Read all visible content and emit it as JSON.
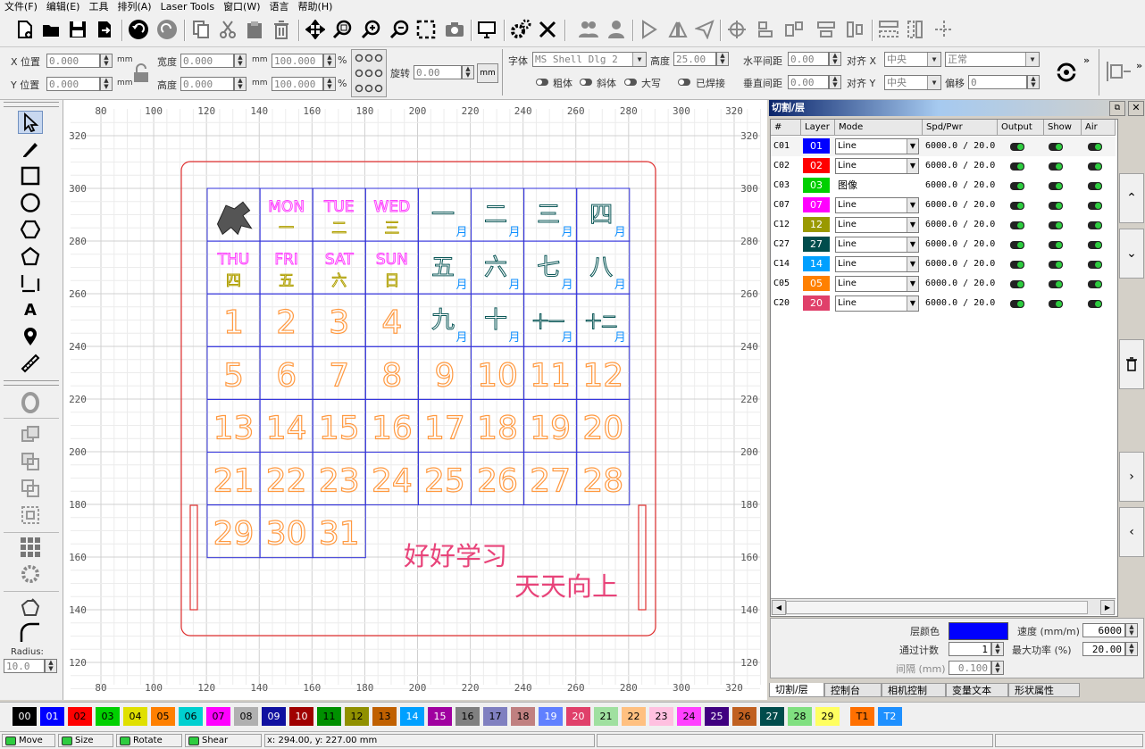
{
  "menubar": {
    "items": [
      "文件(F)",
      "编辑(E)",
      "工具",
      "排列(A)",
      "Laser Tools",
      "窗口(W)",
      "语言",
      "帮助(H)"
    ]
  },
  "properties_bar": {
    "x_pos_label": "X 位置",
    "x_pos_value": "0.000",
    "y_pos_label": "Y 位置",
    "y_pos_value": "0.000",
    "unit_mm": "mm",
    "width_label": "宽度",
    "width_value": "0.000",
    "height_label": "高度",
    "height_value": "0.000",
    "scale_x": "100.000",
    "scale_y": "100.000",
    "percent": "%",
    "rotate_label": "旋转",
    "rotate_value": "0.00",
    "rotate_unit": "mm",
    "font_label": "字体",
    "font_value": "MS Shell Dlg 2",
    "font_height_label": "高度",
    "font_height_value": "25.00",
    "hspacing_label": "水平间距",
    "hspacing_value": "0.00",
    "vspacing_label": "垂直间距",
    "vspacing_value": "0.00",
    "align_x_label": "对齐 X",
    "align_x_value": "中央",
    "align_y_label": "对齐 Y",
    "align_y_value": "中央",
    "style_value": "正常",
    "offset_label": "偏移",
    "offset_value": "0",
    "bold_label": "粗体",
    "italic_label": "斜体",
    "upper_label": "大写",
    "welded_label": "已焊接"
  },
  "toolbox": {
    "radius_label": "Radius:",
    "radius_value": "10.0"
  },
  "rulers": {
    "x_ticks": [
      "80",
      "100",
      "120",
      "140",
      "160",
      "180",
      "200",
      "220",
      "240",
      "260",
      "280",
      "300",
      "320"
    ],
    "y_ticks": [
      "320",
      "300",
      "280",
      "260",
      "240",
      "220",
      "200",
      "180",
      "160",
      "140",
      "120"
    ]
  },
  "calendar": {
    "weekday_en": [
      "MON",
      "TUE",
      "WED",
      "THU",
      "FRI",
      "SAT",
      "SUN"
    ],
    "weekday_cn": [
      "一",
      "二",
      "三",
      "四",
      "五",
      "六",
      "日"
    ],
    "months": [
      "一",
      "二",
      "三",
      "四",
      "五",
      "六",
      "七",
      "八",
      "九",
      "十",
      "十一",
      "十二"
    ],
    "month_suffix": "月",
    "days": [
      "1",
      "2",
      "3",
      "4",
      "5",
      "6",
      "7",
      "8",
      "9",
      "10",
      "11",
      "12",
      "13",
      "14",
      "15",
      "16",
      "17",
      "18",
      "19",
      "20",
      "21",
      "22",
      "23",
      "24",
      "25",
      "26",
      "27",
      "28",
      "29",
      "30",
      "31"
    ],
    "slogan1": "好好学习",
    "slogan2": "天天向上"
  },
  "layer_panel": {
    "title": "切割/层",
    "headers": [
      "#",
      "Layer",
      "Mode",
      "Spd/Pwr",
      "Output",
      "Show",
      "Air"
    ],
    "rows": [
      {
        "id": "C01",
        "layer": "01",
        "color": "#0000ff",
        "mode": "Line",
        "spd": "6000.0 / 20.0"
      },
      {
        "id": "C02",
        "layer": "02",
        "color": "#ff0000",
        "mode": "Line",
        "spd": "6000.0 / 20.0"
      },
      {
        "id": "C03",
        "layer": "03",
        "color": "#00d000",
        "mode": "图像",
        "spd": "6000.0 / 20.0"
      },
      {
        "id": "C07",
        "layer": "07",
        "color": "#ff00ff",
        "mode": "Line",
        "spd": "6000.0 / 20.0"
      },
      {
        "id": "C12",
        "layer": "12",
        "color": "#999900",
        "mode": "Line",
        "spd": "6000.0 / 20.0"
      },
      {
        "id": "C27",
        "layer": "27",
        "color": "#004c4c",
        "mode": "Line",
        "spd": "6000.0 / 20.0"
      },
      {
        "id": "C14",
        "layer": "14",
        "color": "#00a0ff",
        "mode": "Line",
        "spd": "6000.0 / 20.0"
      },
      {
        "id": "C05",
        "layer": "05",
        "color": "#ff8000",
        "mode": "Line",
        "spd": "6000.0 / 20.0"
      },
      {
        "id": "C20",
        "layer": "20",
        "color": "#e0406a",
        "mode": "Line",
        "spd": "6000.0 / 20.0"
      }
    ],
    "props": {
      "layer_color_label": "层颜色",
      "layer_color": "#0000ff",
      "speed_label": "速度 (mm/m)",
      "speed_value": "6000",
      "passes_label": "通过计数",
      "passes_value": "1",
      "max_power_label": "最大功率 (%)",
      "max_power_value": "20.00",
      "interval_label": "间隔 (mm)",
      "interval_value": "0.100"
    },
    "tabs": [
      "切割/层",
      "控制台",
      "相机控制",
      "变量文本",
      "形状属性"
    ]
  },
  "palette": [
    {
      "label": "00",
      "color": "#000000",
      "fg": "#ffffff"
    },
    {
      "label": "01",
      "color": "#0000ff",
      "fg": "#ffffff"
    },
    {
      "label": "02",
      "color": "#ff0000",
      "fg": "#000000"
    },
    {
      "label": "03",
      "color": "#00d000",
      "fg": "#000000"
    },
    {
      "label": "04",
      "color": "#e0e000",
      "fg": "#000000"
    },
    {
      "label": "05",
      "color": "#ff8000",
      "fg": "#000000"
    },
    {
      "label": "06",
      "color": "#00d0d0",
      "fg": "#000000"
    },
    {
      "label": "07",
      "color": "#ff00ff",
      "fg": "#000000"
    },
    {
      "label": "08",
      "color": "#b0b0b0",
      "fg": "#000000"
    },
    {
      "label": "09",
      "color": "#1010a0",
      "fg": "#ffffff"
    },
    {
      "label": "10",
      "color": "#a00000",
      "fg": "#ffffff"
    },
    {
      "label": "11",
      "color": "#009000",
      "fg": "#000000"
    },
    {
      "label": "12",
      "color": "#909000",
      "fg": "#000000"
    },
    {
      "label": "13",
      "color": "#c06000",
      "fg": "#000000"
    },
    {
      "label": "14",
      "color": "#00a0ff",
      "fg": "#ffffff"
    },
    {
      "label": "15",
      "color": "#a000a0",
      "fg": "#ffffff"
    },
    {
      "label": "16",
      "color": "#808080",
      "fg": "#000000"
    },
    {
      "label": "17",
      "color": "#8080c0",
      "fg": "#000000"
    },
    {
      "label": "18",
      "color": "#c08080",
      "fg": "#000000"
    },
    {
      "label": "19",
      "color": "#6080ff",
      "fg": "#ffffff"
    },
    {
      "label": "20",
      "color": "#e0406a",
      "fg": "#ffffff"
    },
    {
      "label": "21",
      "color": "#a0e0a0",
      "fg": "#000000"
    },
    {
      "label": "22",
      "color": "#ffc080",
      "fg": "#000000"
    },
    {
      "label": "23",
      "color": "#ffc0e0",
      "fg": "#000000"
    },
    {
      "label": "24",
      "color": "#ff40ff",
      "fg": "#000000"
    },
    {
      "label": "25",
      "color": "#400080",
      "fg": "#ffffff"
    },
    {
      "label": "26",
      "color": "#c06020",
      "fg": "#000000"
    },
    {
      "label": "27",
      "color": "#004c4c",
      "fg": "#ffffff"
    },
    {
      "label": "28",
      "color": "#80e080",
      "fg": "#000000"
    },
    {
      "label": "29",
      "color": "#ffff60",
      "fg": "#000000"
    },
    {
      "label": "T1",
      "color": "#ff7000",
      "fg": "#000000"
    },
    {
      "label": "T2",
      "color": "#1e90ff",
      "fg": "#ffffff"
    }
  ],
  "statusbar": {
    "move": "Move",
    "size": "Size",
    "rotate": "Rotate",
    "shear": "Shear",
    "coords": "x: 294.00, y: 227.00 mm"
  }
}
